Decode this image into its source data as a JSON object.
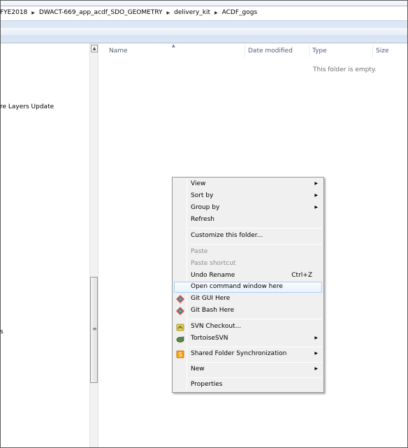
{
  "address_bar": {
    "crumbs": [
      "FYE2018",
      "DWACT-669_app_acdf_SDO_GEOMETRY",
      "delivery_kit",
      "ACDF_gogs"
    ]
  },
  "nav_pane": {
    "items": [
      "re Layers Update",
      "s"
    ]
  },
  "content": {
    "columns": [
      "Name",
      "Date modified",
      "Type",
      "Size"
    ],
    "empty_message": "This folder is empty."
  },
  "context_menu": {
    "view": "View",
    "sort_by": "Sort by",
    "group_by": "Group by",
    "refresh": "Refresh",
    "customize": "Customize this folder...",
    "paste": "Paste",
    "paste_shortcut": "Paste shortcut",
    "undo_rename": "Undo Rename",
    "undo_shortcut": "Ctrl+Z",
    "open_cmd": "Open command window here",
    "git_gui": "Git GUI Here",
    "git_bash": "Git Bash Here",
    "svn_checkout": "SVN Checkout...",
    "tortoise": "TortoiseSVN",
    "shared_sync": "Shared Folder Synchronization",
    "new": "New",
    "properties": "Properties"
  },
  "icons": {
    "submenu": "chevron-right-icon",
    "git": "git-icon",
    "svn_checkout": "svn-checkout-icon",
    "tortoise": "tortoisesvn-icon",
    "shared_sync": "sync-icon"
  },
  "colors": {
    "highlight_border": "#aeccf1",
    "menu_bg": "#f0f0f0",
    "header_text": "#4c607a"
  }
}
